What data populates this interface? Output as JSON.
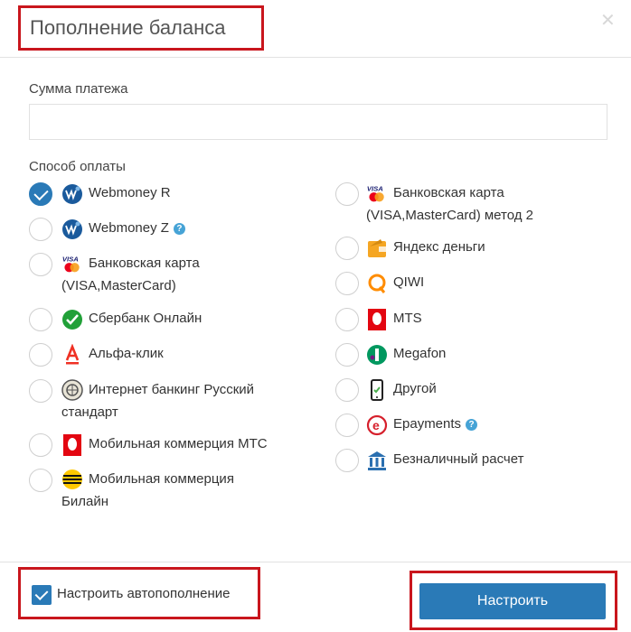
{
  "dialog": {
    "title": "Пополнение баланса",
    "close_icon": "close-icon"
  },
  "amount": {
    "label": "Сумма платежа",
    "value": "",
    "placeholder": ""
  },
  "payment": {
    "label": "Способ оплаты",
    "selected": "Webmoney R",
    "left": [
      {
        "line1": "Webmoney R",
        "line2": "",
        "icon": "webmoney-icon",
        "help": false,
        "checked": true
      },
      {
        "line1": "Webmoney Z",
        "line2": "",
        "icon": "webmoney-icon",
        "help": true,
        "checked": false
      },
      {
        "line1": "Банковская карта",
        "line2": "(VISA,MasterCard)",
        "icon": "visa-mastercard-icon",
        "help": false,
        "checked": false
      },
      {
        "line1": "Сбербанк Онлайн",
        "line2": "",
        "icon": "sberbank-icon",
        "help": false,
        "checked": false
      },
      {
        "line1": "Альфа-клик",
        "line2": "",
        "icon": "alfa-bank-icon",
        "help": false,
        "checked": false
      },
      {
        "line1": "Интернет банкинг Русский",
        "line2": "стандарт",
        "icon": "russian-standard-icon",
        "help": false,
        "checked": false
      },
      {
        "line1": "Мобильная коммерция МТС",
        "line2": "",
        "icon": "mts-icon",
        "help": false,
        "checked": false
      },
      {
        "line1": "Мобильная коммерция",
        "line2": "Билайн",
        "icon": "beeline-icon",
        "help": false,
        "checked": false
      }
    ],
    "right": [
      {
        "line1": "Банковская карта",
        "line2": "(VISA,MasterCard) метод 2",
        "icon": "visa-mastercard-icon",
        "help": false,
        "checked": false
      },
      {
        "line1": "Яндекс деньги",
        "line2": "",
        "icon": "yandex-money-icon",
        "help": false,
        "checked": false
      },
      {
        "line1": "QIWI",
        "line2": "",
        "icon": "qiwi-icon",
        "help": false,
        "checked": false
      },
      {
        "line1": "MTS",
        "line2": "",
        "icon": "mts-icon",
        "help": false,
        "checked": false
      },
      {
        "line1": "Megafon",
        "line2": "",
        "icon": "megafon-icon",
        "help": false,
        "checked": false
      },
      {
        "line1": "Другой",
        "line2": "",
        "icon": "mobile-phone-icon",
        "help": false,
        "checked": false
      },
      {
        "line1": "Epayments",
        "line2": "",
        "icon": "epayments-icon",
        "help": true,
        "checked": false
      },
      {
        "line1": "Безналичный расчет",
        "line2": "",
        "icon": "bank-icon",
        "help": false,
        "checked": false
      }
    ]
  },
  "footer": {
    "autopay_label": "Настроить автопополнение",
    "autopay_checked": true,
    "submit_label": "Настроить"
  },
  "colors": {
    "accent": "#2a7ab7",
    "highlight": "#c9161d"
  }
}
